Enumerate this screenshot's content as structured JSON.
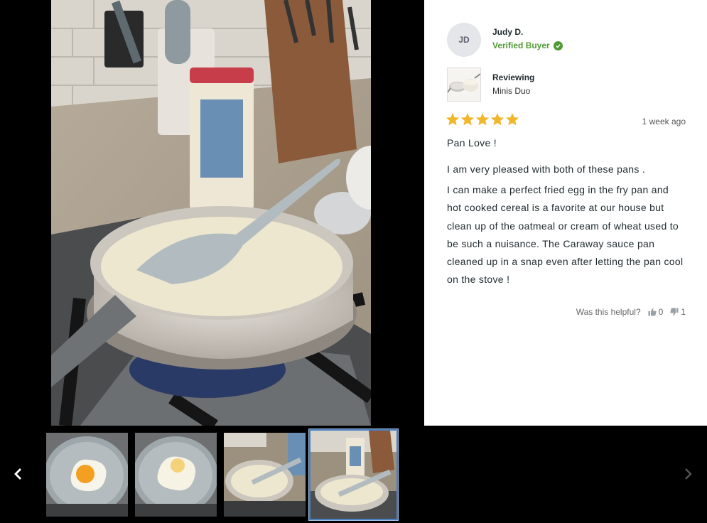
{
  "review": {
    "author_initials": "JD",
    "author_name": "Judy D.",
    "verified_label": "Verified Buyer",
    "reviewing_label": "Reviewing",
    "product_name": "Minis Duo",
    "rating": 5,
    "date": "1 week ago",
    "title": "Pan Love !",
    "body": [
      "I am very pleased with both of these pans .",
      "I can make a perfect fried egg in the fry pan and hot cooked cereal is a favorite at our house but clean up of the oatmeal or cream of wheat used to be such a nuisance. The Caraway sauce pan cleaned up in a snap even after letting the pan cool on the stove !"
    ],
    "helpful_label": "Was this helpful?",
    "helpful_yes": "0",
    "helpful_no": "1"
  },
  "carousel": {
    "active_index": 3,
    "thumbnails": [
      {
        "icon": "fried-egg-photo"
      },
      {
        "icon": "fried-egg-photo"
      },
      {
        "icon": "saucepan-photo"
      },
      {
        "icon": "saucepan-photo"
      }
    ]
  },
  "colors": {
    "verified": "#4f9a33",
    "star": "#f1b72c",
    "active_thumb_border": "#4a7fbf"
  }
}
